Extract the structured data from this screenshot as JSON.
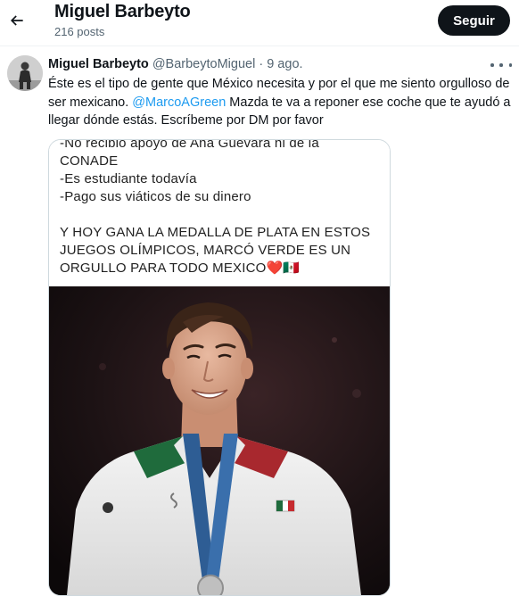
{
  "header": {
    "title": "Miguel Barbeyto",
    "posts_count": "216 posts",
    "follow_label": "Seguir"
  },
  "tweet": {
    "display_name": "Miguel Barbeyto",
    "handle": "@BarbeytoMiguel",
    "separator": "·",
    "time": "9 ago.",
    "text_part1": "Éste es el tipo de gente que México necesita y por el que me siento orgulloso de ser mexicano. ",
    "mention": "@MarcoAGreen",
    "text_part2": " Mazda te va a reponer ese coche que te ayudó a llegar dónde estás. Escríbeme por DM por favor"
  },
  "media": {
    "card_lines": [
      "-No recibió apoyo de Ana Guevara ni de la",
      "CONADE",
      "-Es estudiante todavía",
      "-Pago sus viáticos de su dinero",
      "",
      "Y HOY GANA LA MEDALLA DE PLATA EN ESTOS",
      "JUEGOS OLÍMPICOS, MARCÓ VERDE ES UN",
      "ORGULLO PARA TODO MEXICO❤️🇲🇽"
    ],
    "photo_subject": "boxer-with-silver-medal"
  },
  "colors": {
    "accent_link": "#1d9bf0",
    "follow_button_bg": "#0f1419",
    "secondary_text": "#536471",
    "border": "#cfd9de"
  },
  "icons": {
    "back": "arrow-left-icon",
    "more": "more-dots-icon"
  }
}
